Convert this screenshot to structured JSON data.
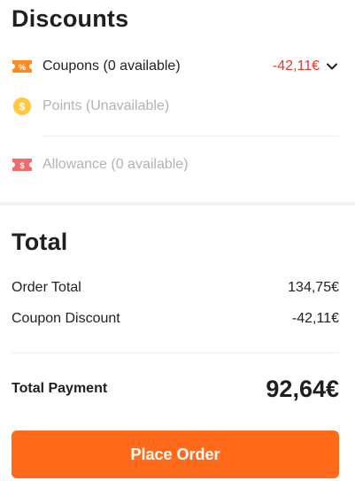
{
  "discounts": {
    "title": "Discounts",
    "coupons": {
      "label": "Coupons (0 available)",
      "amount": "-42,11€",
      "icon": "coupon-icon",
      "icon_text": "%"
    },
    "points": {
      "label": "Points (Unavailable)",
      "icon": "points-coin-icon",
      "icon_text": "$"
    },
    "allowance": {
      "label": "Allowance (0 available)",
      "icon": "allowance-ticket-icon",
      "icon_text": "$"
    }
  },
  "total": {
    "title": "Total",
    "order_total_label": "Order Total",
    "order_total_value": "134,75€",
    "coupon_discount_label": "Coupon Discount",
    "coupon_discount_value": "-42,11€",
    "payment_label": "Total Payment",
    "payment_value": "92,64€"
  },
  "actions": {
    "place_order_label": "Place Order"
  },
  "colors": {
    "accent": "#ff6b1a",
    "discount_red": "#e8382f",
    "disabled_text": "#b3b3b3"
  }
}
